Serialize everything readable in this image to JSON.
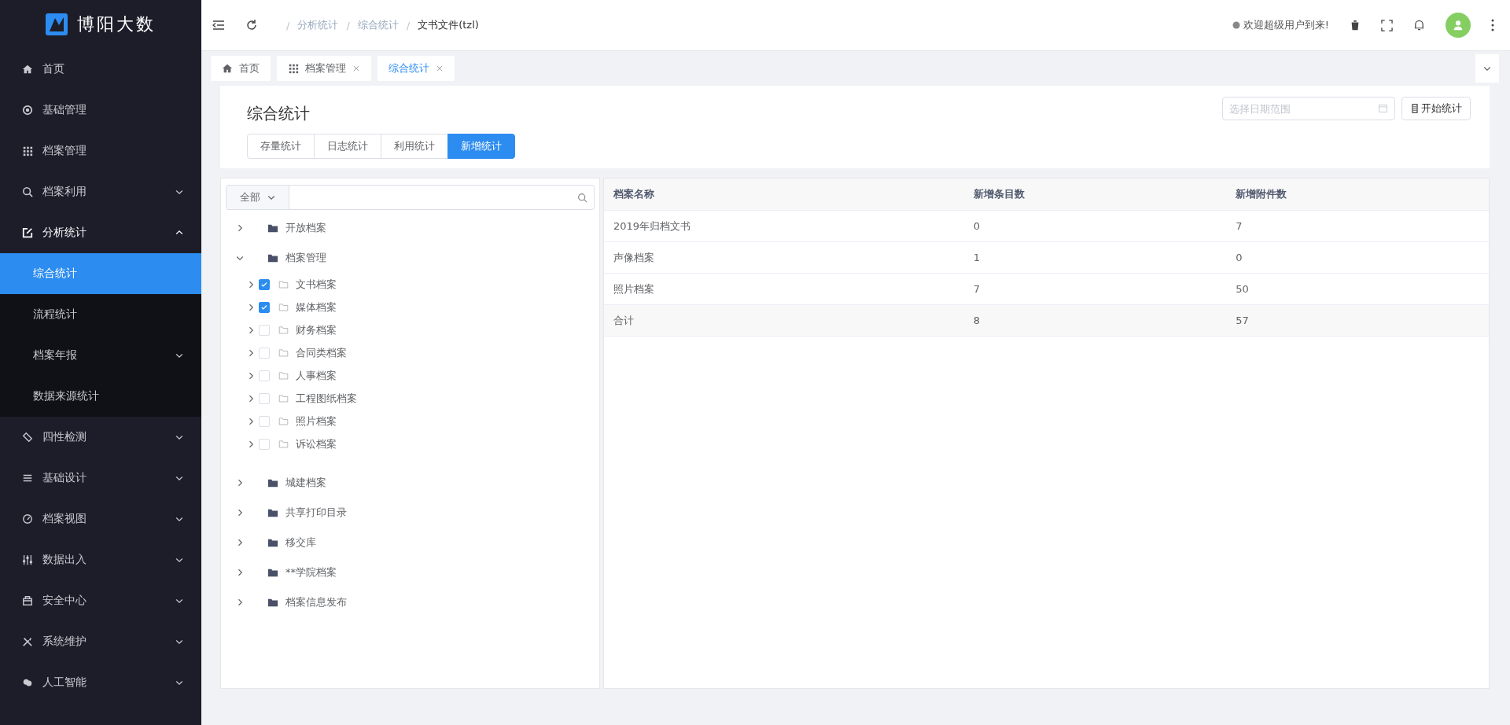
{
  "brand": {
    "name": "博阳大数"
  },
  "sidebar": {
    "items": [
      {
        "label": "首页",
        "kind": "link",
        "selected": false
      },
      {
        "label": "基础管理",
        "kind": "link",
        "selected": false
      },
      {
        "label": "档案管理",
        "kind": "link",
        "selected": false
      },
      {
        "label": "档案利用",
        "kind": "submenu",
        "expanded": false,
        "selected": false
      },
      {
        "label": "分析统计",
        "kind": "submenu",
        "expanded": true,
        "selected": false,
        "children": [
          {
            "label": "综合统计",
            "kind": "link",
            "selected": true
          },
          {
            "label": "流程统计",
            "kind": "link",
            "selected": false
          },
          {
            "label": "档案年报",
            "kind": "submenu",
            "expanded": false,
            "selected": false
          },
          {
            "label": "数据来源统计",
            "kind": "link",
            "selected": false
          }
        ]
      },
      {
        "label": "四性检测",
        "kind": "submenu",
        "expanded": false,
        "selected": false
      },
      {
        "label": "基础设计",
        "kind": "submenu",
        "expanded": false,
        "selected": false
      },
      {
        "label": "档案视图",
        "kind": "submenu",
        "expanded": false,
        "selected": false
      },
      {
        "label": "数据出入",
        "kind": "submenu",
        "expanded": false,
        "selected": false
      },
      {
        "label": "安全中心",
        "kind": "submenu",
        "expanded": false,
        "selected": false
      },
      {
        "label": "系统维护",
        "kind": "submenu",
        "expanded": false,
        "selected": false
      },
      {
        "label": "人工智能",
        "kind": "submenu",
        "expanded": false,
        "selected": false
      }
    ]
  },
  "header": {
    "breadcrumbs": [
      {
        "separator": "/",
        "label": "分析统计"
      },
      {
        "separator": "/",
        "label": "综合统计"
      },
      {
        "separator": "/",
        "label": "文书文件(tzl)"
      }
    ],
    "welcome": "欢迎超级用户到来!"
  },
  "tabs": [
    {
      "label": "首页",
      "selected": false,
      "closable": false
    },
    {
      "label": "档案管理",
      "selected": false,
      "closable": true
    },
    {
      "label": "综合统计",
      "selected": true,
      "closable": true
    }
  ],
  "page": {
    "title": "综合统计",
    "stat_tabs": [
      {
        "label": "存量统计",
        "selected": false
      },
      {
        "label": "日志统计",
        "selected": false
      },
      {
        "label": "利用统计",
        "selected": false
      },
      {
        "label": "新增统计",
        "selected": true
      }
    ],
    "date_range": {
      "placeholder": "选择日期范围"
    },
    "start_button": "开始统计"
  },
  "tree": {
    "filter": "全部",
    "nodes": [
      {
        "label": "开放档案",
        "expanded": false
      },
      {
        "label": "档案管理",
        "expanded": true,
        "children": [
          {
            "label": "文书档案",
            "checked": true,
            "expanded": false
          },
          {
            "label": "媒体档案",
            "checked": true,
            "expanded": false
          },
          {
            "label": "财务档案",
            "checked": false,
            "expanded": false
          },
          {
            "label": "合同类档案",
            "checked": false,
            "expanded": false
          },
          {
            "label": "人事档案",
            "checked": false,
            "expanded": false
          },
          {
            "label": "工程图纸档案",
            "checked": false,
            "expanded": false
          },
          {
            "label": "照片档案",
            "checked": false,
            "expanded": false
          },
          {
            "label": "诉讼档案",
            "checked": false,
            "expanded": false
          }
        ]
      },
      {
        "label": "城建档案",
        "expanded": false
      },
      {
        "label": "共享打印目录",
        "expanded": false
      },
      {
        "label": "移交库",
        "expanded": false
      },
      {
        "label": "**学院档案",
        "expanded": false
      },
      {
        "label": "档案信息发布",
        "expanded": false
      }
    ]
  },
  "table": {
    "columns": [
      "档案名称",
      "新增条目数",
      "新增附件数"
    ],
    "rows": [
      [
        "2019年归档文书",
        "0",
        "7"
      ],
      [
        "声像档案",
        "1",
        "0"
      ],
      [
        "照片档案",
        "7",
        "50"
      ]
    ],
    "total": [
      "合计",
      "8",
      "57"
    ]
  }
}
